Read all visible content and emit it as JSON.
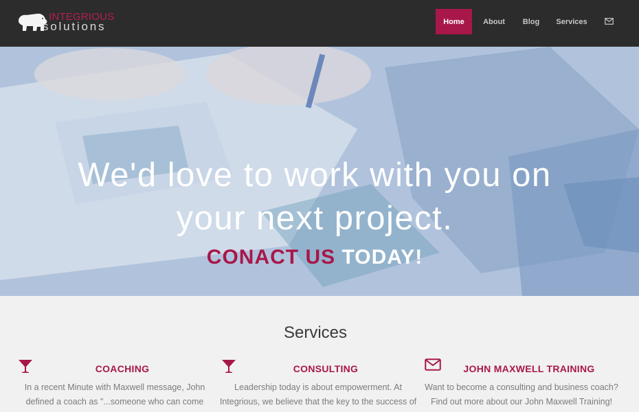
{
  "logo": {
    "top": "INTEGRIOUS",
    "bottom": "solutions",
    "icon": "polar-bear-icon"
  },
  "nav": {
    "home": "Home",
    "about": "About",
    "blog": "Blog",
    "services": "Services",
    "mail_icon": "envelope-icon"
  },
  "hero": {
    "line1": "We'd love to work with you on",
    "line2": "your next project.",
    "cta_part1": "CONACT US",
    "cta_part2": "TODAY!"
  },
  "services": {
    "title": "Services",
    "items": [
      {
        "icon": "cocktail-glass-icon",
        "heading": "COACHING",
        "line1": "In a recent Minute with Maxwell message, John",
        "line2": "defined a coach as \"...someone who can come"
      },
      {
        "icon": "cocktail-glass-icon",
        "heading": "CONSULTING",
        "line1": "Leadership today is about empowerment. At",
        "line2": "Integrious, we believe that the key to the success of"
      },
      {
        "icon": "envelope-icon",
        "heading": "JOHN MAXWELL TRAINING",
        "line1": "Want to become a consulting and business coach?",
        "line2": "Find out more about our John Maxwell Training!"
      }
    ]
  },
  "colors": {
    "accent": "#a8174a",
    "header_bg": "#2c2c2c",
    "body_bg": "#f1f1f1"
  }
}
